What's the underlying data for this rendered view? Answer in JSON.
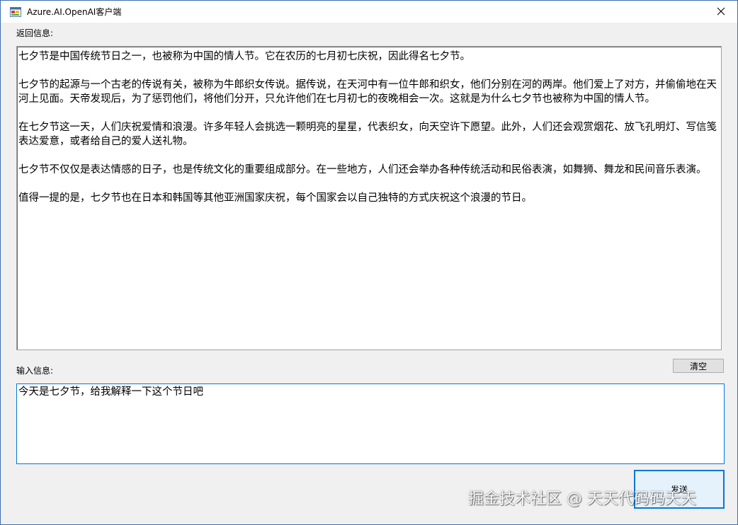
{
  "window": {
    "title": "Azure.AI.OpenAI客户端",
    "accent_color": "#0078d7"
  },
  "labels": {
    "output": "返回信息:",
    "input": "输入信息:"
  },
  "output": {
    "paragraphs": [
      "七夕节是中国传统节日之一，也被称为中国的情人节。它在农历的七月初七庆祝，因此得名七夕节。",
      "七夕节的起源与一个古老的传说有关，被称为牛郎织女传说。据传说，在天河中有一位牛郎和织女，他们分别在河的两岸。他们爱上了对方，并偷偷地在天河上见面。天帝发现后，为了惩罚他们，将他们分开，只允许他们在七月初七的夜晚相会一次。这就是为什么七夕节也被称为中国的情人节。",
      "在七夕节这一天，人们庆祝爱情和浪漫。许多年轻人会挑选一颗明亮的星星，代表织女，向天空许下愿望。此外，人们还会观赏烟花、放飞孔明灯、写信笺表达爱意，或者给自己的爱人送礼物。",
      "七夕节不仅仅是表达情感的日子，也是传统文化的重要组成部分。在一些地方，人们还会举办各种传统活动和民俗表演，如舞狮、舞龙和民间音乐表演。",
      "值得一提的是，七夕节也在日本和韩国等其他亚洲国家庆祝，每个国家会以自己独特的方式庆祝这个浪漫的节日。"
    ]
  },
  "input": {
    "value": "今天是七夕节，给我解释一下这个节日吧"
  },
  "buttons": {
    "clear": "清空",
    "send": "发送"
  },
  "watermark": "掘金技术社区 @ 天天代码码天天"
}
